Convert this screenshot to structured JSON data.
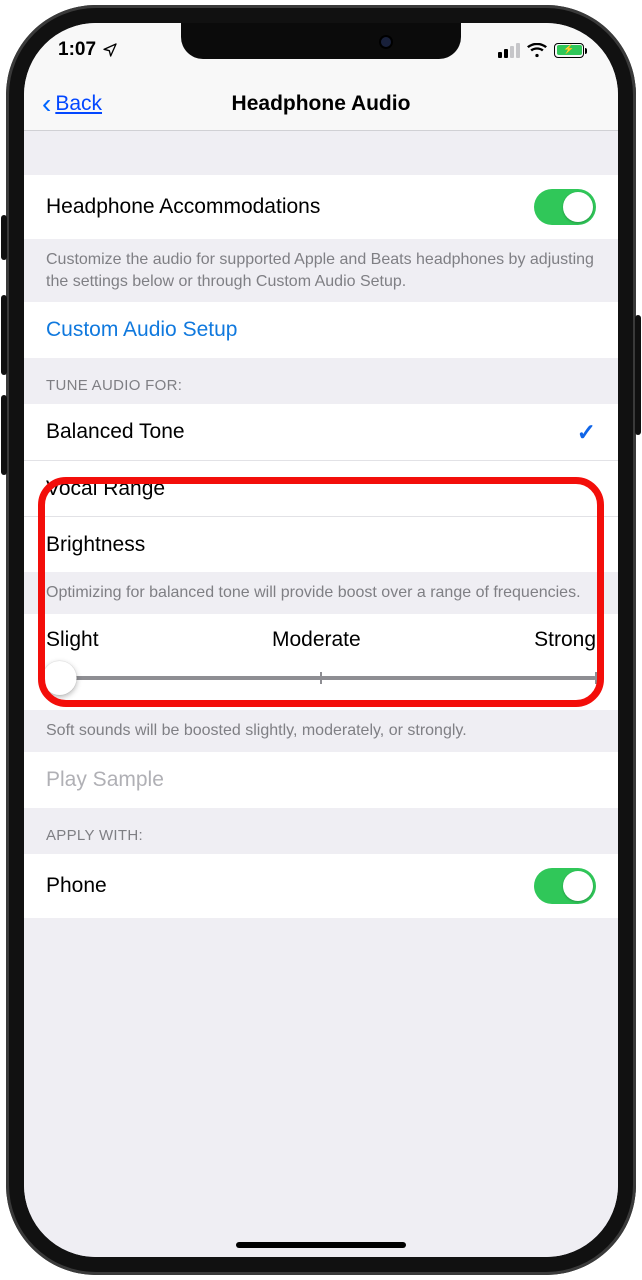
{
  "status": {
    "time": "1:07"
  },
  "nav": {
    "back": "Back",
    "title": "Headphone Audio"
  },
  "accommodations": {
    "label": "Headphone Accommodations",
    "footer": "Customize the audio for supported Apple and Beats headphones by adjusting the settings below or through Custom Audio Setup."
  },
  "custom_setup": {
    "label": "Custom Audio Setup"
  },
  "tune": {
    "header": "Tune Audio For:",
    "options": [
      "Balanced Tone",
      "Vocal Range",
      "Brightness"
    ],
    "footer": "Optimizing for balanced tone will provide boost over a range of frequencies."
  },
  "slider": {
    "labels": [
      "Slight",
      "Moderate",
      "Strong"
    ],
    "footer": "Soft sounds will be boosted slightly, moderately, or strongly."
  },
  "play_sample": "Play Sample",
  "apply": {
    "header": "Apply With:",
    "phone": "Phone"
  }
}
